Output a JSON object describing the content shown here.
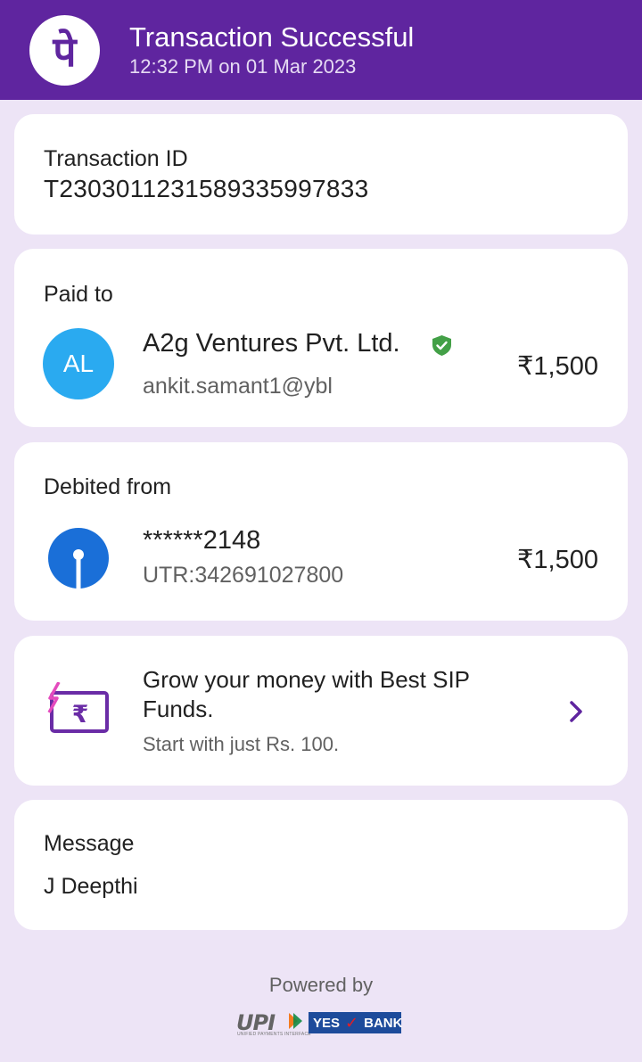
{
  "header": {
    "logo_text": "पे",
    "title": "Transaction Successful",
    "timestamp": "12:32 PM on 01 Mar 2023",
    "color": "#5f259f"
  },
  "transaction": {
    "label": "Transaction ID",
    "id": "T2303011231589335997833"
  },
  "paid_to": {
    "label": "Paid to",
    "avatar_initials": "AL",
    "avatar_color": "#2aaaf0",
    "name": "A2g Ventures Pvt. Ltd.",
    "verified_icon": "verified-shield-icon",
    "upi_id": "ankit.samant1@ybl",
    "amount": "₹1,500"
  },
  "debited_from": {
    "label": "Debited from",
    "bank_icon": "sbi-bank-icon",
    "account": "******2148",
    "utr": "UTR:342691027800",
    "amount": "₹1,500"
  },
  "promo": {
    "icon": "rupee-card-icon",
    "title": "Grow your money with Best SIP Funds.",
    "subtitle": "Start with just Rs. 100.",
    "chevron_icon": "chevron-right-icon"
  },
  "message": {
    "label": "Message",
    "text": "J Deepthi"
  },
  "footer": {
    "powered_by": "Powered by",
    "upi_logo": "UPI",
    "upi_tagline": "UNIFIED PAYMENTS INTERFACE",
    "bank_logo_left": "YES",
    "bank_logo_right": "BANK"
  }
}
